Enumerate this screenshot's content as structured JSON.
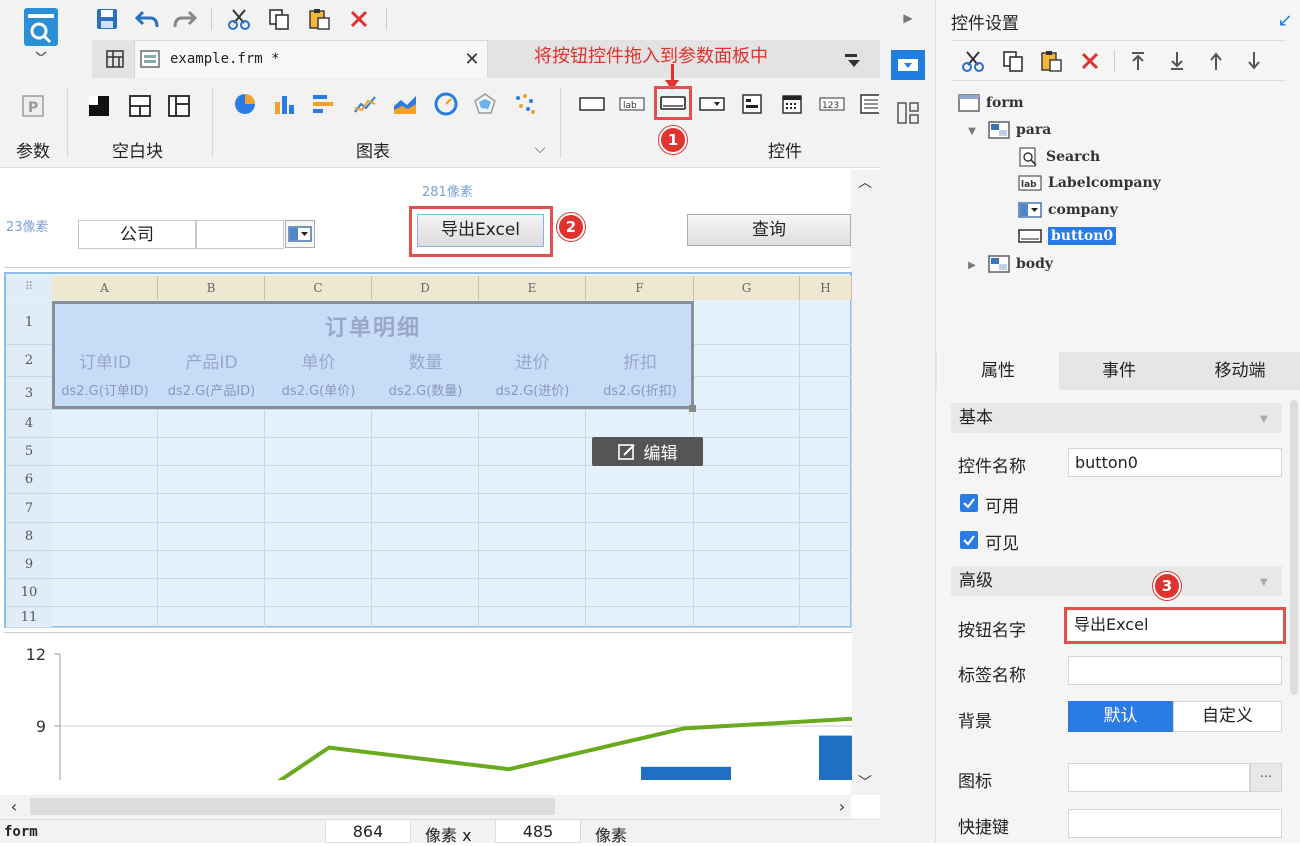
{
  "toolbar": {
    "quick_icons": [
      "save-icon",
      "undo-icon",
      "redo-icon",
      "cut-icon",
      "copy-icon",
      "paste-icon",
      "delete-icon"
    ],
    "tab_label": "example.frm *",
    "annotation_text": "将按钮控件拖入到参数面板中",
    "groups": {
      "param": "参数",
      "blank": "空白块",
      "chart": "图表",
      "widget": "控件"
    },
    "badges": [
      "1",
      "2",
      "3"
    ]
  },
  "canvas": {
    "ruler_top": "281像素",
    "ruler_left": "23像素",
    "company_label": "公司",
    "export_button": "导出Excel",
    "query_button": "查询",
    "edit_button": "编辑",
    "columns": [
      "A",
      "B",
      "C",
      "D",
      "E",
      "F",
      "G",
      "H"
    ],
    "rows": [
      "1",
      "2",
      "3",
      "4",
      "5",
      "6",
      "7",
      "8",
      "9",
      "10",
      "11"
    ],
    "report_title": "订单明细",
    "headers": [
      "订单ID",
      "产品ID",
      "单价",
      "数量",
      "进价",
      "折扣"
    ],
    "fields": [
      "ds2.G(订单ID)",
      "ds2.G(产品ID)",
      "ds2.G(单价)",
      "ds2.G(数量)",
      "ds2.G(进价)",
      "ds2.G(折扣)"
    ]
  },
  "chart_data": {
    "type": "bar",
    "yticks": [
      "12",
      "9"
    ],
    "ylim": [
      6,
      12
    ],
    "colors": {
      "bar": "#1f6fc5",
      "line": "#6aaa1e"
    },
    "bar_values": [
      6.2,
      7.3,
      8.6
    ],
    "line_values": [
      6.0,
      8.1,
      7.2,
      8.9,
      9.3
    ]
  },
  "status": {
    "left": "form",
    "width_value": "864",
    "unit1": "像素 x",
    "height_value": "485",
    "unit2": "像素"
  },
  "panel": {
    "title": "控件设置",
    "tree": [
      "form",
      "para",
      "Search",
      "Labelcompany",
      "company",
      "button0",
      "body"
    ],
    "tabs": [
      "属性",
      "事件",
      "移动端"
    ],
    "basic": "基本",
    "control_name_label": "控件名称",
    "control_name_value": "button0",
    "enabled": "可用",
    "visible": "可见",
    "advanced": "高级",
    "button_name_label": "按钮名字",
    "button_name_value": "导出Excel",
    "tag_name_label": "标签名称",
    "background_label": "背景",
    "bg_default": "默认",
    "bg_custom": "自定义",
    "icon_label": "图标",
    "shortcut_label": "快捷键",
    "more": "···"
  }
}
